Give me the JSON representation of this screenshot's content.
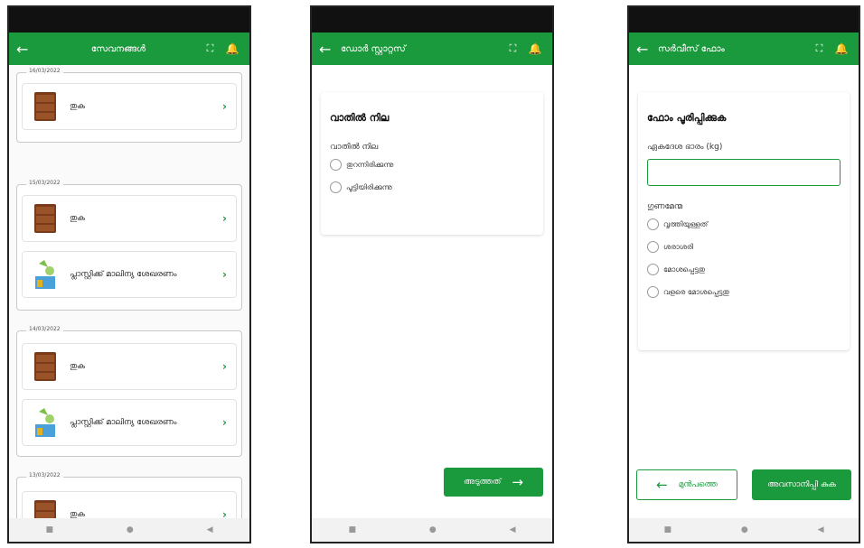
{
  "screens": [
    {
      "title": "സേവനങ്ങൾ",
      "groups": [
        {
          "date": "16/03/2022",
          "items": [
            {
              "label": "തുക",
              "icon": "cabinet-icon"
            }
          ]
        },
        {
          "date": "15/03/2022",
          "items": [
            {
              "label": "തുക",
              "icon": "cabinet-icon"
            },
            {
              "label": "പ്ലാസ്റ്റിക്ക് മാലിന്യ ശേഖരണം",
              "icon": "recycle-icon"
            }
          ]
        },
        {
          "date": "14/03/2022",
          "items": [
            {
              "label": "തുക",
              "icon": "cabinet-icon"
            },
            {
              "label": "പ്ലാസ്റ്റിക്ക് മാലിന്യ ശേഖരണം",
              "icon": "recycle-icon"
            }
          ]
        },
        {
          "date": "13/03/2022",
          "items": [
            {
              "label": "തുക",
              "icon": "cabinet-icon"
            }
          ]
        }
      ]
    },
    {
      "title": "ഡോർ സ്റ്റാറ്റസ്",
      "card_heading": "വാതിൽ നില",
      "question": "വാതിൽ നില",
      "options": [
        "തുറന്നിരിക്കുന്നു",
        "പൂട്ടിയിരിക്കുന്നു"
      ],
      "next_label": "അടുത്തത്"
    },
    {
      "title": "സർവീസ് ഫോം",
      "card_heading": "ഫോം പൂരിപ്പിക്കുക",
      "weight_label": "ഏകദേശ ഭാരം (kg)",
      "weight_value": "",
      "quality_label": "ഗുണമേന്മ",
      "options": [
        "വൃത്തിയുള്ളത്",
        "ശരാശരി",
        "മോശപ്പെട്ടതു",
        "വളരെ മോശപ്പെട്ടതു"
      ],
      "prev_label": "മുൻപത്തെ",
      "finish_label": "അവസാനിപ്പി കുക"
    }
  ],
  "colors": {
    "brand": "#1a9a3c",
    "statusbar": "#111111"
  },
  "icons": {
    "back": "arrow-left-icon",
    "fullscreen": "fullscreen-icon",
    "bell": "bell-icon",
    "chevron": "chevron-right-icon"
  }
}
